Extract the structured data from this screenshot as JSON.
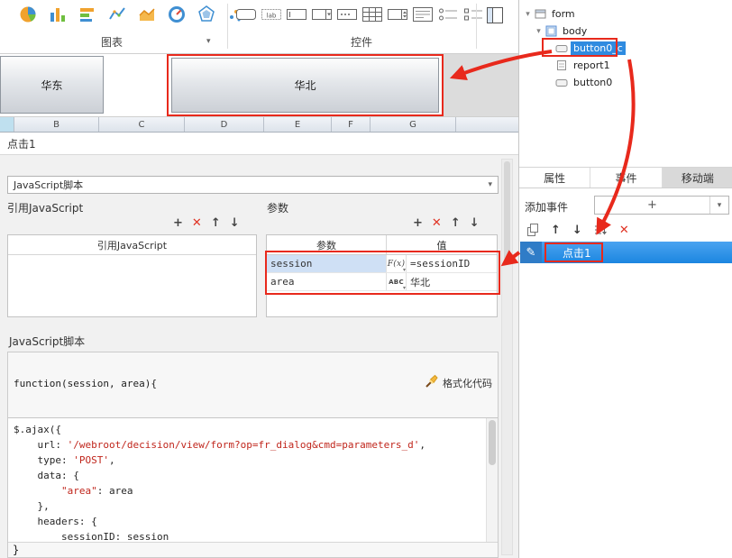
{
  "glyphs": {
    "plus": "+",
    "cross": "✕",
    "up": "↑",
    "down": "↓",
    "chevron": "▾",
    "pencil": "✎"
  },
  "colors": {
    "annotation": "#e8291c",
    "selection_blue": "#1e87e0",
    "param_selected_row": "#cfe0f5"
  },
  "toolbar": {
    "chart_label": "图表",
    "control_label": "控件",
    "label_icon_glyph": "lab",
    "chart_icons": [
      "pie-chart-icon",
      "column-chart-icon",
      "bar-chart-icon",
      "line-chart-icon",
      "area-chart-icon",
      "gauge-chart-icon",
      "radar-chart-icon",
      "scatter-chart-icon"
    ],
    "control_icons": [
      "button-widget-icon",
      "label-widget-icon",
      "textbox-widget-icon",
      "combobox-widget-icon",
      "password-widget-icon",
      "grid-widget-icon",
      "spinner-widget-icon",
      "multiline-widget-icon",
      "radiolist-widget-icon",
      "checklist-widget-icon"
    ]
  },
  "form_preview": {
    "buttons": [
      {
        "label": "华东"
      },
      {
        "label": "华北"
      }
    ]
  },
  "spreadsheet": {
    "columns": [
      "B",
      "C",
      "D",
      "E",
      "F",
      "G"
    ]
  },
  "dialog": {
    "title": "点击1",
    "event_type_value": "JavaScript脚本",
    "reference": {
      "label": "引用JavaScript",
      "table_header": "引用JavaScript"
    },
    "params": {
      "label": "参数",
      "col_param": "参数",
      "col_value": "值",
      "rows": [
        {
          "name": "session",
          "type_glyph": "F(x)",
          "value": "=sessionID",
          "selected": true
        },
        {
          "name": "area",
          "type_glyph": "ABC",
          "value": "华北",
          "selected": false
        }
      ]
    },
    "script": {
      "label": "JavaScript脚本",
      "signature": "function(session, area){",
      "format_label": "格式化代码",
      "closing_brace": "}",
      "lines": [
        [
          {
            "t": "$.ajax({",
            "c": "p"
          }
        ],
        [
          {
            "t": "    url: ",
            "c": "p"
          },
          {
            "t": "'/webroot/decision/view/form?op=fr_dialog&cmd=parameters_d'",
            "c": "s"
          },
          {
            "t": ",",
            "c": "p"
          }
        ],
        [
          {
            "t": "    type: ",
            "c": "p"
          },
          {
            "t": "'POST'",
            "c": "s"
          },
          {
            "t": ",",
            "c": "p"
          }
        ],
        [
          {
            "t": "    data: {",
            "c": "p"
          }
        ],
        [
          {
            "t": "        ",
            "c": "p"
          },
          {
            "t": "\"area\"",
            "c": "s"
          },
          {
            "t": ": area",
            "c": "p"
          }
        ],
        [
          {
            "t": "    },",
            "c": "p"
          }
        ],
        [
          {
            "t": "    headers: {",
            "c": "p"
          }
        ],
        [
          {
            "t": "        sessionID: session",
            "c": "p"
          }
        ]
      ]
    }
  },
  "panel": {
    "tree": [
      {
        "label": "form",
        "icon": "form-icon",
        "indent": 0,
        "expander": true,
        "selected": false
      },
      {
        "label": "body",
        "icon": "body-icon",
        "indent": 1,
        "expander": true,
        "selected": false
      },
      {
        "label": "button0_c",
        "icon": "button-node-icon",
        "indent": 2,
        "expander": false,
        "selected": true
      },
      {
        "label": "report1",
        "icon": "report-node-icon",
        "indent": 2,
        "expander": false,
        "selected": false
      },
      {
        "label": "button0",
        "icon": "button-node-icon",
        "indent": 2,
        "expander": false,
        "selected": false
      }
    ],
    "tabs": [
      "属性",
      "事件",
      "移动端"
    ],
    "active_tab": "事件",
    "add_event_label": "添加事件",
    "event_name": "点击1"
  }
}
